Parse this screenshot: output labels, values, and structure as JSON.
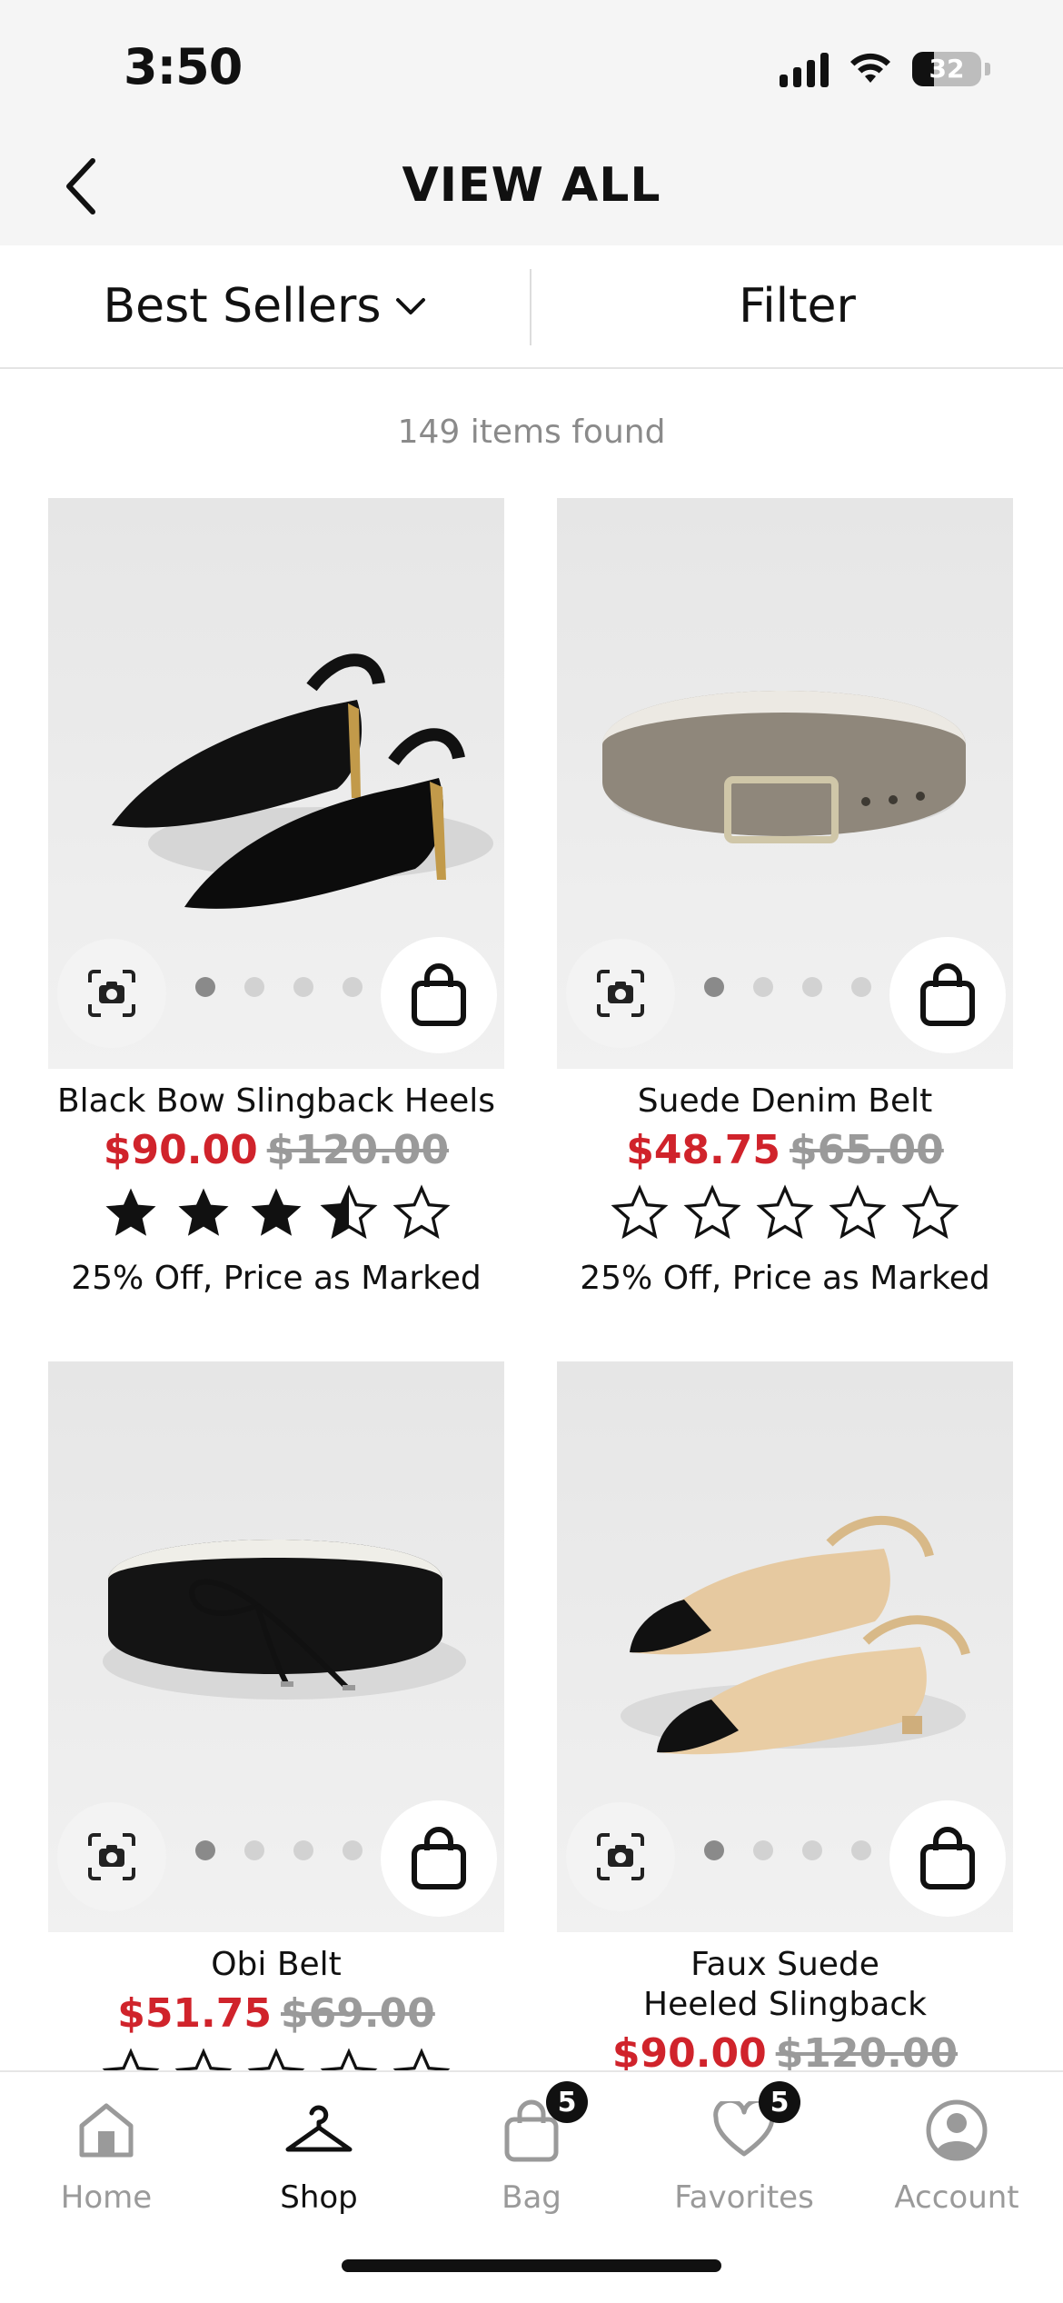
{
  "status_bar": {
    "time": "3:50",
    "battery": "32"
  },
  "header": {
    "title": "VIEW ALL"
  },
  "toolbar": {
    "sort_label": "Best Sellers",
    "filter_label": "Filter"
  },
  "results": {
    "count_text": "149 items found"
  },
  "products": [
    {
      "name": "Black Bow Slingback Heels",
      "sale_price": "$90.00",
      "original_price": "$120.00",
      "rating": 3.5,
      "promo": "25% Off, Price as Marked"
    },
    {
      "name": "Suede Denim Belt",
      "sale_price": "$48.75",
      "original_price": "$65.00",
      "rating": 0,
      "promo": "25% Off, Price as Marked"
    },
    {
      "name": "Obi Belt",
      "sale_price": "$51.75",
      "original_price": "$69.00",
      "rating": 0
    },
    {
      "name_line1": "Faux Suede",
      "name_line2": "Heeled Slingback",
      "sale_price": "$90.00",
      "original_price": "$120.00"
    }
  ],
  "tab_bar": {
    "home": "Home",
    "shop": "Shop",
    "bag": "Bag",
    "bag_badge": "5",
    "favorites": "Favorites",
    "favorites_badge": "5",
    "account": "Account"
  },
  "colors": {
    "sale": "#d0232b",
    "strikethrough": "#9a9a9a",
    "text": "#111111",
    "inactive_tab": "#9a9a9a"
  }
}
